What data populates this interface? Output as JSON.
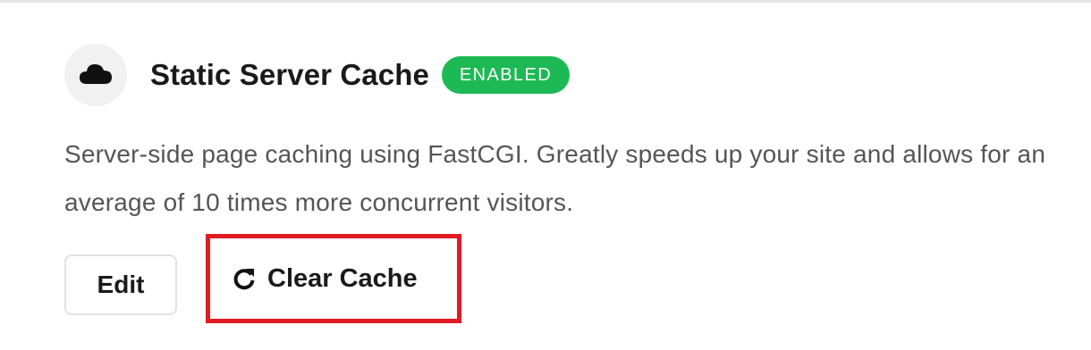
{
  "card": {
    "icon": "cloud-icon",
    "title": "Static Server Cache",
    "status_badge": "ENABLED",
    "description": "Server-side page caching using FastCGI. Greatly speeds up your site and allows for an average of 10 times more concurrent visitors.",
    "actions": {
      "edit_label": "Edit",
      "clear_cache_label": "Clear Cache",
      "clear_cache_icon": "refresh-icon"
    }
  },
  "colors": {
    "badge_green": "#1db954",
    "highlight_red": "#e01b24",
    "icon_bg": "#f1f1f1"
  }
}
